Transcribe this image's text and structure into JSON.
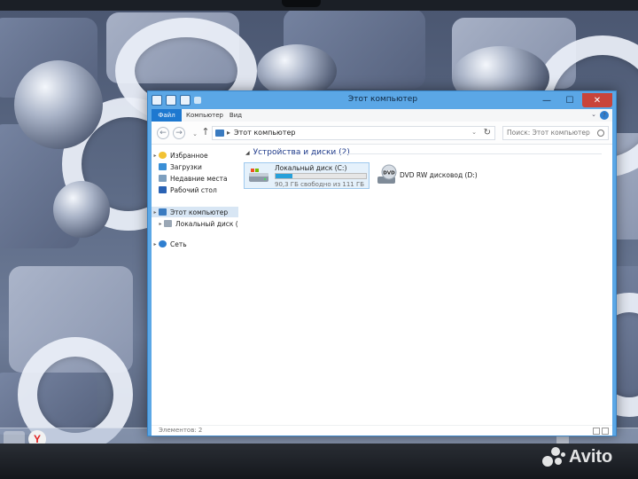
{
  "window": {
    "title": "Этот компьютер",
    "minimize": "—",
    "maximize": "☐",
    "close": "✕"
  },
  "ribbon": {
    "tabs": [
      "Файл",
      "Компьютер",
      "Вид"
    ],
    "collapse": "⌄",
    "help": "?"
  },
  "address": {
    "back": "←",
    "forward": "→",
    "recent": "⌄",
    "up": "↑",
    "separator": "▸",
    "path": "Этот компьютер",
    "dropdown": "⌄",
    "refresh": "↻",
    "search_placeholder": "Поиск: Этот компьютер"
  },
  "nav": {
    "favorites": "Избранное",
    "downloads": "Загрузки",
    "recent": "Недавние места",
    "desktop": "Рабочий стол",
    "this_pc": "Этот компьютер",
    "local_disk": "Локальный диск (C:",
    "network": "Сеть",
    "expand": "▸"
  },
  "main": {
    "group_header": "Устройства и диски (2)",
    "collapse": "◢",
    "drives": [
      {
        "label": "Локальный диск (C:)",
        "free": "90,3 ГБ свободно из 111 ГБ",
        "used_fraction": 0.19
      },
      {
        "label": "DVD RW дисковод (D:)",
        "badge": "DVD"
      }
    ]
  },
  "status": {
    "items": "Элементов: 2"
  },
  "taskbar": {
    "yandex": "Y"
  },
  "watermark": {
    "text": "Avito"
  },
  "colors": {
    "accent": "#1d78d0",
    "window_frame": "#5ba7e6",
    "selection": "#d8e6f4",
    "progress": "#26a0da",
    "close": "#c9443a"
  },
  "icons": [
    "pc-icon",
    "star-icon",
    "download-icon",
    "recent-places-icon",
    "desktop-icon",
    "drive-icon",
    "network-icon",
    "dvd-icon",
    "search-icon"
  ]
}
